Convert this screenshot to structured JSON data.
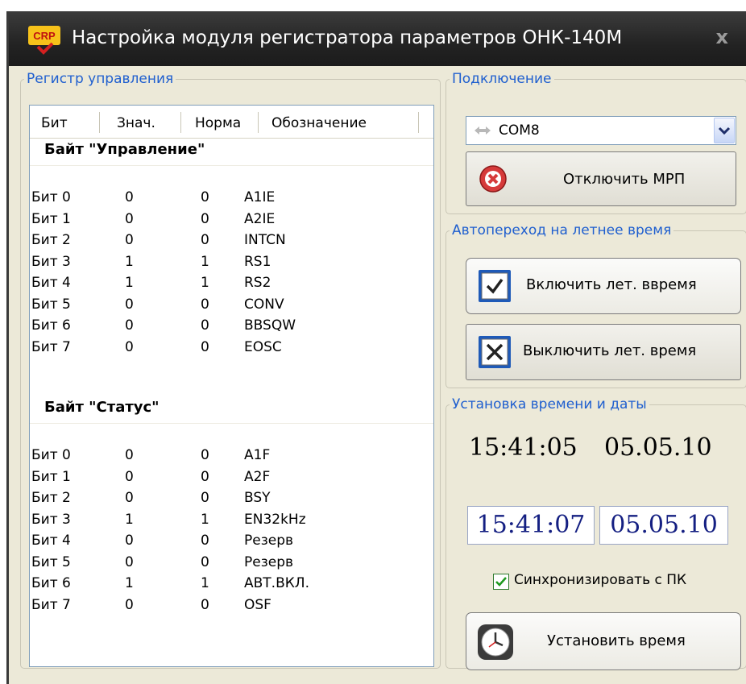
{
  "window": {
    "icon_text": "CRP",
    "title": "Настройка модуля регистратора параметров ОНК-140М",
    "close_label": "x"
  },
  "register": {
    "legend": "Регистр управления",
    "columns": [
      "Бит",
      "Знач.",
      "Норма",
      "Обозначение"
    ],
    "sections": [
      {
        "title": "Байт \"Управление\"",
        "rows": [
          [
            "Бит 0",
            "0",
            "0",
            "A1IE"
          ],
          [
            "Бит 1",
            "0",
            "0",
            "A2IE"
          ],
          [
            "Бит 2",
            "0",
            "0",
            "INTCN"
          ],
          [
            "Бит 3",
            "1",
            "1",
            "RS1"
          ],
          [
            "Бит 4",
            "1",
            "1",
            "RS2"
          ],
          [
            "Бит 5",
            "0",
            "0",
            "CONV"
          ],
          [
            "Бит 6",
            "0",
            "0",
            "BBSQW"
          ],
          [
            "Бит 7",
            "0",
            "0",
            "EOSC"
          ]
        ]
      },
      {
        "title": "Байт \"Статус\"",
        "rows": [
          [
            "Бит 0",
            "0",
            "0",
            "A1F"
          ],
          [
            "Бит 1",
            "0",
            "0",
            "A2F"
          ],
          [
            "Бит 2",
            "0",
            "0",
            "BSY"
          ],
          [
            "Бит 3",
            "1",
            "1",
            "EN32kHz"
          ],
          [
            "Бит 4",
            "0",
            "0",
            "Резерв"
          ],
          [
            "Бит 5",
            "0",
            "0",
            "Резерв"
          ],
          [
            "Бит 6",
            "1",
            "1",
            "АВТ.ВКЛ."
          ],
          [
            "Бит 7",
            "0",
            "0",
            "OSF"
          ]
        ]
      }
    ]
  },
  "connection": {
    "legend": "Подключение",
    "port": "COM8",
    "disconnect_label": "Отключить МРП"
  },
  "dst": {
    "legend": "Автопереход на летнее время",
    "enable_label": "Включить лет. вв­ремя",
    "disable_label": "Выключить лет. время"
  },
  "datetime": {
    "legend": "Установка времени и даты",
    "device_time": "15:41:05",
    "device_date": "05.05.10",
    "pc_time": "15:41:07",
    "pc_date": "05.05.10",
    "sync_label": "Синхронизировать с ПК",
    "sync_checked": true,
    "set_label": "Установить время"
  },
  "colors": {
    "accent": "#1f5fcf",
    "titlebar": "#2b2b2b",
    "panel": "#ece9d8",
    "time_text": "#141f82"
  }
}
